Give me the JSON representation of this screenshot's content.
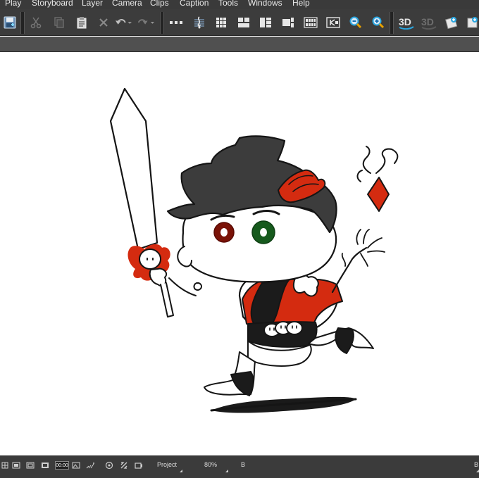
{
  "menu": {
    "items": [
      "Play",
      "Storyboard",
      "Layer",
      "Camera",
      "Clips",
      "Caption",
      "Tools",
      "Windows",
      "Help"
    ]
  },
  "toolbar": {
    "icons": [
      "save-icon",
      "cut-icon",
      "copy-icon",
      "paste-icon",
      "delete-icon",
      "undo-icon",
      "redo-icon",
      "timeline-icon",
      "sound-icon",
      "grid-icon",
      "panel-layout-icon",
      "panel-layout-2-icon",
      "panel-layout-3-icon",
      "thumbnails-icon",
      "camera-view-icon",
      "zoom-out-icon",
      "zoom-in-icon",
      "3d-on-icon",
      "3d-off-icon",
      "add-layer-icon",
      "add-panel-icon"
    ],
    "label_3d": "3D",
    "label_3d_off": "3D"
  },
  "statusbar": {
    "timecode": "00:00",
    "view_mode": "Project",
    "zoom": "80%",
    "channel": "B",
    "right_label": "B"
  },
  "colors": {
    "menubar": "#3a3a3a",
    "toolbar": "#3c3c3c",
    "statusbar": "#3b3b3b",
    "ink": "#151515",
    "red": "#d42b10",
    "gray_fill": "#3c3c3c",
    "eye_left": "#7a1207",
    "eye_right": "#165a1d",
    "accent_blue": "#2aa6e0"
  }
}
